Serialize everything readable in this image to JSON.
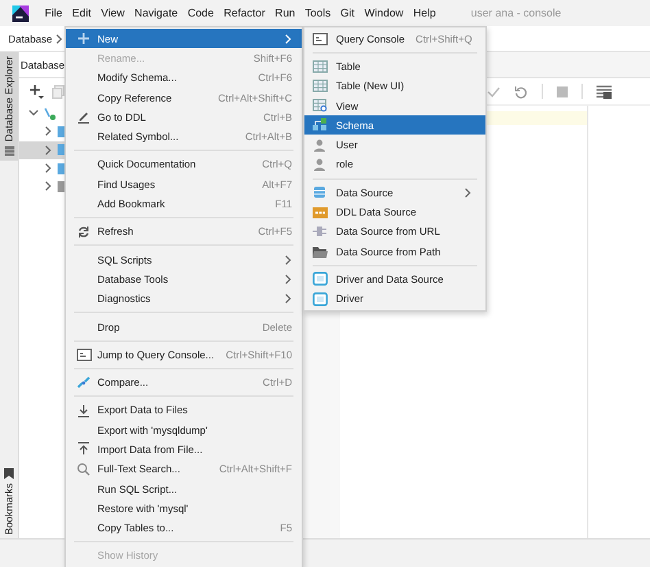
{
  "menu_bar": {
    "items": [
      "File",
      "Edit",
      "View",
      "Navigate",
      "Code",
      "Refactor",
      "Run",
      "Tools",
      "Git",
      "Window",
      "Help"
    ],
    "title": "user ana - console"
  },
  "breadcrumb": "Database",
  "side_stripe": [
    {
      "label": "Database Explorer",
      "selected": true
    },
    {
      "label": "Bookmarks",
      "selected": false
    }
  ],
  "database_panel": {
    "title": "Database",
    "tree": [
      {
        "expanded": true,
        "selected": false,
        "children": [
          {
            "expanded": false,
            "selected": false
          },
          {
            "expanded": false,
            "selected": true
          },
          {
            "expanded": false,
            "selected": false
          },
          {
            "expanded": false,
            "selected": false
          }
        ]
      }
    ]
  },
  "context_menu": {
    "items": [
      {
        "kind": "item",
        "label": "New",
        "submenu": true,
        "selected": true,
        "disabled": false
      },
      {
        "kind": "item",
        "label": "Rename...",
        "shortcut": "Shift+F6",
        "selected": false,
        "disabled": true
      },
      {
        "kind": "item",
        "label": "Modify Schema...",
        "shortcut": "Ctrl+F6",
        "selected": false,
        "disabled": false
      },
      {
        "kind": "item",
        "label": "Copy Reference",
        "shortcut": "Ctrl+Alt+Shift+C",
        "selected": false,
        "disabled": false
      },
      {
        "kind": "item",
        "label": "Go to DDL",
        "shortcut": "Ctrl+B",
        "selected": false,
        "disabled": false
      },
      {
        "kind": "item",
        "label": "Related Symbol...",
        "shortcut": "Ctrl+Alt+B",
        "selected": false,
        "disabled": false
      },
      {
        "kind": "separator"
      },
      {
        "kind": "item",
        "label": "Quick Documentation",
        "shortcut": "Ctrl+Q",
        "selected": false,
        "disabled": false
      },
      {
        "kind": "item",
        "label": "Find Usages",
        "shortcut": "Alt+F7",
        "selected": false,
        "disabled": false
      },
      {
        "kind": "item",
        "label": "Add Bookmark",
        "shortcut": "F11",
        "selected": false,
        "disabled": false
      },
      {
        "kind": "separator"
      },
      {
        "kind": "item",
        "label": "Refresh",
        "shortcut": "Ctrl+F5",
        "selected": false,
        "disabled": false
      },
      {
        "kind": "separator"
      },
      {
        "kind": "item",
        "label": "SQL Scripts",
        "submenu": true,
        "selected": false,
        "disabled": false
      },
      {
        "kind": "item",
        "label": "Database Tools",
        "submenu": true,
        "selected": false,
        "disabled": false
      },
      {
        "kind": "item",
        "label": "Diagnostics",
        "submenu": true,
        "selected": false,
        "disabled": false
      },
      {
        "kind": "separator"
      },
      {
        "kind": "item",
        "label": "Drop",
        "shortcut": "Delete",
        "selected": false,
        "disabled": false
      },
      {
        "kind": "separator"
      },
      {
        "kind": "item",
        "label": "Jump to Query Console...",
        "shortcut": "Ctrl+Shift+F10",
        "selected": false,
        "disabled": false
      },
      {
        "kind": "separator"
      },
      {
        "kind": "item",
        "label": "Compare...",
        "shortcut": "Ctrl+D",
        "selected": false,
        "disabled": false
      },
      {
        "kind": "separator"
      },
      {
        "kind": "item",
        "label": "Export Data to Files",
        "selected": false,
        "disabled": false
      },
      {
        "kind": "item",
        "label": "Export with 'mysqldump'",
        "selected": false,
        "disabled": false
      },
      {
        "kind": "item",
        "label": "Import Data from File...",
        "selected": false,
        "disabled": false
      },
      {
        "kind": "item",
        "label": "Full-Text Search...",
        "shortcut": "Ctrl+Alt+Shift+F",
        "selected": false,
        "disabled": false
      },
      {
        "kind": "item",
        "label": "Run SQL Script...",
        "selected": false,
        "disabled": false
      },
      {
        "kind": "item",
        "label": "Restore with 'mysql'",
        "selected": false,
        "disabled": false
      },
      {
        "kind": "item",
        "label": "Copy Tables to...",
        "shortcut": "F5",
        "selected": false,
        "disabled": false
      },
      {
        "kind": "separator"
      },
      {
        "kind": "item",
        "label": "Show History",
        "selected": false,
        "disabled": true
      }
    ]
  },
  "submenu": {
    "items": [
      {
        "kind": "item",
        "label": "Query Console",
        "shortcut": "Ctrl+Shift+Q",
        "selected": false
      },
      {
        "kind": "separator"
      },
      {
        "kind": "item",
        "label": "Table",
        "selected": false
      },
      {
        "kind": "item",
        "label": "Table (New UI)",
        "selected": false
      },
      {
        "kind": "item",
        "label": "View",
        "selected": false
      },
      {
        "kind": "item",
        "label": "Schema",
        "selected": true
      },
      {
        "kind": "item",
        "label": "User",
        "selected": false
      },
      {
        "kind": "item",
        "label": "role",
        "selected": false
      },
      {
        "kind": "separator"
      },
      {
        "kind": "item",
        "label": "Data Source",
        "submenu": true,
        "selected": false
      },
      {
        "kind": "item",
        "label": "DDL Data Source",
        "selected": false
      },
      {
        "kind": "item",
        "label": "Data Source from URL",
        "selected": false
      },
      {
        "kind": "item",
        "label": "Data Source from Path",
        "selected": false
      },
      {
        "kind": "separator"
      },
      {
        "kind": "item",
        "label": "Driver and Data Source",
        "selected": false
      },
      {
        "kind": "item",
        "label": "Driver",
        "selected": false
      }
    ]
  }
}
